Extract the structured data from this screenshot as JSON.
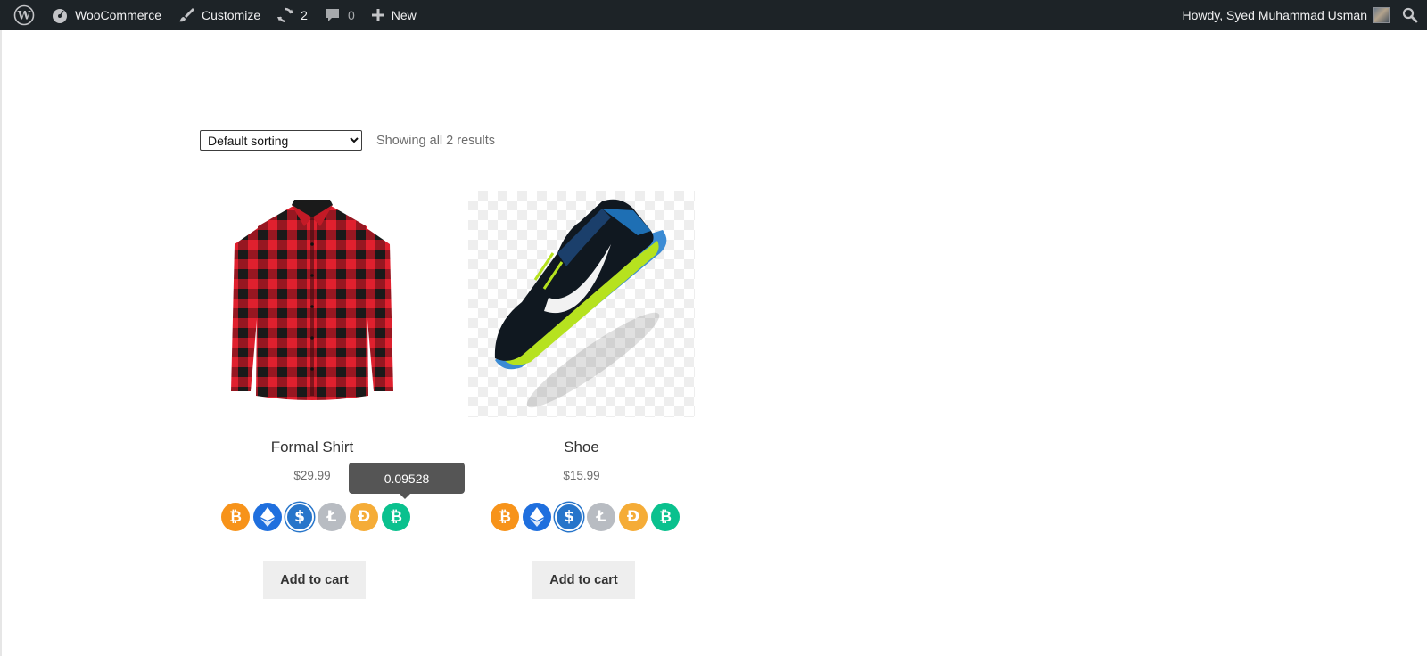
{
  "adminbar": {
    "wp_icon": "wordpress-logo-icon",
    "items": [
      {
        "icon": "dashboard-gauge-icon",
        "label": "WooCommerce"
      },
      {
        "icon": "paintbrush-icon",
        "label": "Customize"
      },
      {
        "icon": "updates-refresh-icon",
        "label": "2"
      },
      {
        "icon": "comment-bubble-icon",
        "label": "0"
      },
      {
        "icon": "plus-icon",
        "label": "New"
      }
    ],
    "greeting": "Howdy, Syed Muhammad Usman",
    "search_icon": "search-icon",
    "bg_color": "#1d2327"
  },
  "shop": {
    "sort_options": [
      "Default sorting"
    ],
    "sort_selected": "Default sorting",
    "result_count": "Showing all 2 results"
  },
  "products": [
    {
      "name": "Formal Shirt",
      "price": "$29.99",
      "image": "red-black-plaid-shirt",
      "add_to_cart": "Add to cart"
    },
    {
      "name": "Shoe",
      "price": "$15.99",
      "image": "blue-green-running-shoe",
      "add_to_cart": "Add to cart"
    }
  ],
  "crypto_coins": [
    {
      "name": "Bitcoin",
      "icon": "bitcoin-icon",
      "color": "#f7931a",
      "glyph": "₿"
    },
    {
      "name": "Ethereum",
      "icon": "ethereum-icon",
      "color": "#1f6fde",
      "glyph": ""
    },
    {
      "name": "USD Coin",
      "icon": "usdc-icon",
      "color": "#2775ca",
      "glyph": "$"
    },
    {
      "name": "Litecoin",
      "icon": "litecoin-icon",
      "color": "#b8bcc2",
      "glyph": "Ł"
    },
    {
      "name": "Dai",
      "icon": "dai-icon",
      "color": "#f5ac37",
      "glyph": "Đ"
    },
    {
      "name": "Bitcoin Cash",
      "icon": "bitcoin-cash-icon",
      "color": "#0ac18e",
      "glyph": "₿"
    }
  ],
  "tooltip": {
    "value": "0.09528"
  }
}
